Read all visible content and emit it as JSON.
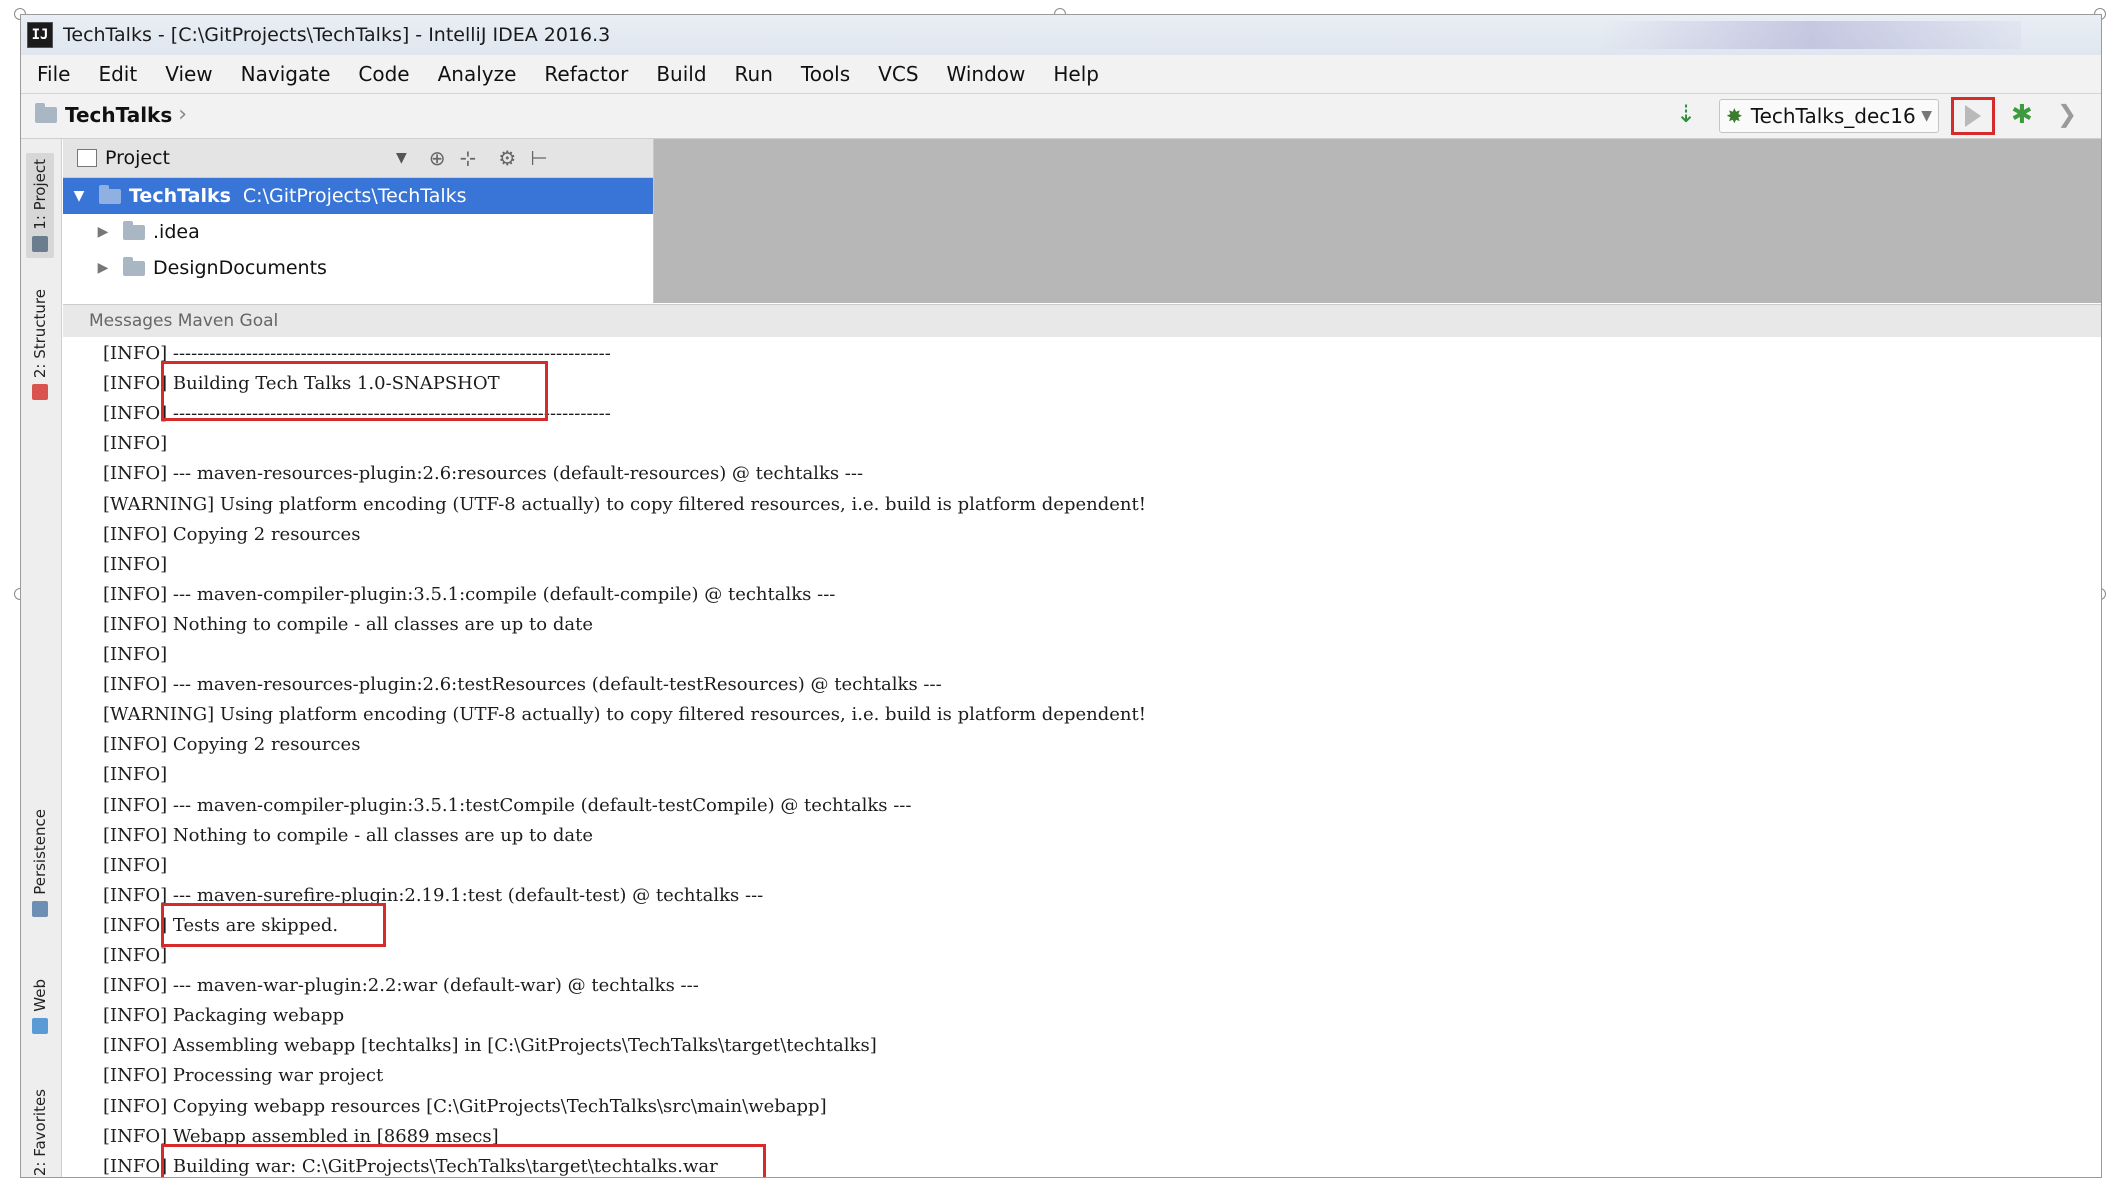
{
  "window": {
    "app_icon_text": "IJ",
    "title": "TechTalks - [C:\\GitProjects\\TechTalks] - IntelliJ IDEA 2016.3"
  },
  "menu": [
    "File",
    "Edit",
    "View",
    "Navigate",
    "Code",
    "Analyze",
    "Refactor",
    "Build",
    "Run",
    "Tools",
    "VCS",
    "Window",
    "Help"
  ],
  "navbar": {
    "breadcrumb": "TechTalks",
    "run_config": "TechTalks_dec16"
  },
  "left_strip": {
    "tabs": [
      "1: Project",
      "2: Structure",
      "Persistence",
      "Web",
      "2: Favorites"
    ]
  },
  "project_panel": {
    "header": "Project",
    "tree": [
      {
        "name": "TechTalks",
        "path": "C:\\GitProjects\\TechTalks",
        "expanded": true,
        "selected": true,
        "level": 0
      },
      {
        "name": ".idea",
        "path": "",
        "expanded": false,
        "selected": false,
        "level": 1
      },
      {
        "name": "DesignDocuments",
        "path": "",
        "expanded": false,
        "selected": false,
        "level": 1
      }
    ]
  },
  "messages": {
    "header": "Messages Maven Goal",
    "lines": [
      "[INFO] ------------------------------------------------------------------------",
      "[INFO] Building Tech Talks 1.0-SNAPSHOT",
      "[INFO] ------------------------------------------------------------------------",
      "[INFO]",
      "[INFO] --- maven-resources-plugin:2.6:resources (default-resources) @ techtalks ---",
      "[WARNING] Using platform encoding (UTF-8 actually) to copy filtered resources, i.e. build is platform dependent!",
      "[INFO] Copying 2 resources",
      "[INFO]",
      "[INFO] --- maven-compiler-plugin:3.5.1:compile (default-compile) @ techtalks ---",
      "[INFO] Nothing to compile - all classes are up to date",
      "[INFO]",
      "[INFO] --- maven-resources-plugin:2.6:testResources (default-testResources) @ techtalks ---",
      "[WARNING] Using platform encoding (UTF-8 actually) to copy filtered resources, i.e. build is platform dependent!",
      "[INFO] Copying 2 resources",
      "[INFO]",
      "[INFO] --- maven-compiler-plugin:3.5.1:testCompile (default-testCompile) @ techtalks ---",
      "[INFO] Nothing to compile - all classes are up to date",
      "[INFO]",
      "[INFO] --- maven-surefire-plugin:2.19.1:test (default-test) @ techtalks ---",
      "[INFO] Tests are skipped.",
      "[INFO]",
      "[INFO] --- maven-war-plugin:2.2:war (default-war) @ techtalks ---",
      "[INFO] Packaging webapp",
      "[INFO] Assembling webapp [techtalks] in [C:\\GitProjects\\TechTalks\\target\\techtalks]",
      "[INFO] Processing war project",
      "[INFO] Copying webapp resources [C:\\GitProjects\\TechTalks\\src\\main\\webapp]",
      "[INFO] Webapp assembled in [8689 msecs]",
      "[INFO] Building war: C:\\GitProjects\\TechTalks\\target\\techtalks.war"
    ],
    "highlighted_lines": [
      1,
      19,
      27
    ]
  },
  "colors": {
    "highlight_box": "#d52b2b",
    "selection": "#3875d7",
    "editor_background": "#b7b7b7"
  }
}
